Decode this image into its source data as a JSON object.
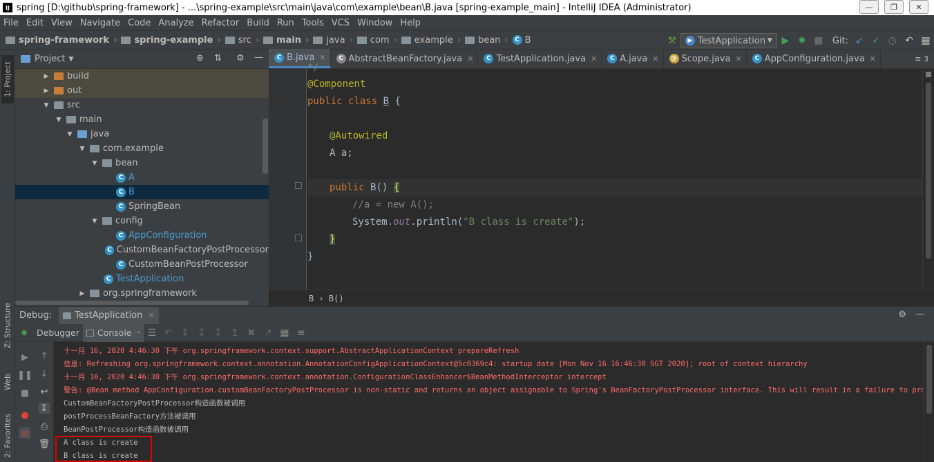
{
  "window": {
    "title": "spring [D:\\github\\spring-framework] - ...\\spring-example\\src\\main\\java\\com\\example\\bean\\B.java [spring-example_main] - IntelliJ IDEA (Administrator)",
    "app_icon": "IJ"
  },
  "menu": [
    "File",
    "Edit",
    "View",
    "Navigate",
    "Code",
    "Analyze",
    "Refactor",
    "Build",
    "Run",
    "Tools",
    "VCS",
    "Window",
    "Help"
  ],
  "nav": {
    "crumbs": [
      "spring-framework",
      "spring-example",
      "src",
      "main",
      "java",
      "com",
      "example",
      "bean",
      "B"
    ],
    "run_config": "TestApplication",
    "git_label": "Git:"
  },
  "left_strip": {
    "project_tab": "1: Project",
    "structure_tab": "Z: Structure",
    "web_tab": "Web",
    "favorites_tab": "2: Favorites"
  },
  "project": {
    "title": "Project",
    "tree": [
      {
        "label": "build",
        "level": 2
      },
      {
        "label": "out",
        "level": 2
      },
      {
        "label": "src",
        "level": 2
      },
      {
        "label": "main",
        "level": 3
      },
      {
        "label": "java",
        "level": 4
      },
      {
        "label": "com.example",
        "level": 5
      },
      {
        "label": "bean",
        "level": 6
      },
      {
        "label": "A",
        "level": 7
      },
      {
        "label": "B",
        "level": 7
      },
      {
        "label": "SpringBean",
        "level": 7
      },
      {
        "label": "config",
        "level": 6
      },
      {
        "label": "AppConfiguration",
        "level": 7
      },
      {
        "label": "CustomBeanFactoryPostProcessor",
        "level": 7
      },
      {
        "label": "CustomBeanPostProcessor",
        "level": 7
      },
      {
        "label": "TestApplication",
        "level": 6
      },
      {
        "label": "org.springframework",
        "level": 5
      }
    ]
  },
  "editor": {
    "tabs": [
      "B.java",
      "AbstractBeanFactory.java",
      "TestApplication.java",
      "A.java",
      "Scope.java",
      "AppConfiguration.java"
    ],
    "tabs_overflow": "≡ 3",
    "code": {
      "comment_tail": "*/",
      "l1_anno": "@Component",
      "l2_kw": "public class ",
      "l2_name": "B",
      "l2_rest": " {",
      "l3_anno": "@Autowired",
      "l4": "A a;",
      "l5_kw": "public ",
      "l5_name": "B() ",
      "l5_brace": "{",
      "l6_cmt": "//a = new A();",
      "l7_obj": "System.",
      "l7_field": "out",
      "l7_call": ".println(",
      "l7_str": "\"B class is create\"",
      "l7_end": ");",
      "l8_brace": "}",
      "l9_brace": "}"
    },
    "breadcrumb": "B  ›  B()"
  },
  "debug": {
    "label": "Debug:",
    "run_name": "TestApplication",
    "debugger_tab": "Debugger",
    "console_tab": "Console",
    "console_lines": [
      {
        "text": "十一月 16, 2020 4:46:30 下午 org.springframework.context.support.AbstractApplicationContext prepareRefresh",
        "color": "red"
      },
      {
        "text": "信息: Refreshing org.springframework.context.annotation.AnnotationConfigApplicationContext@5c0369c4: startup date [Mon Nov 16 16:46:30 SGT 2020]; root of context hierarchy",
        "color": "red"
      },
      {
        "text": "十一月 16, 2020 4:46:30 下午 org.springframework.context.annotation.ConfigurationClassEnhancer$BeanMethodInterceptor intercept",
        "color": "red"
      },
      {
        "text": "警告: @Bean method AppConfiguration.customBeanFactoryPostProcessor is non-static and returns an object assignable to Spring's BeanFactoryPostProcessor interface. This will result in a failure to process annotations",
        "color": "red"
      },
      {
        "text": "CustomBeanFactoryPostProcessor构造函数被调用",
        "color": "normal"
      },
      {
        "text": "postProcessBeanFactory方法被调用",
        "color": "normal"
      },
      {
        "text": "BeanPostProcessor构造函数被调用",
        "color": "normal"
      },
      {
        "text": "A class is create",
        "color": "normal"
      },
      {
        "text": "B class is create",
        "color": "normal"
      }
    ]
  },
  "colors": {
    "accent": "#4a88c7",
    "error_text": "#ff6b68",
    "annotation_box": "#e00000"
  }
}
